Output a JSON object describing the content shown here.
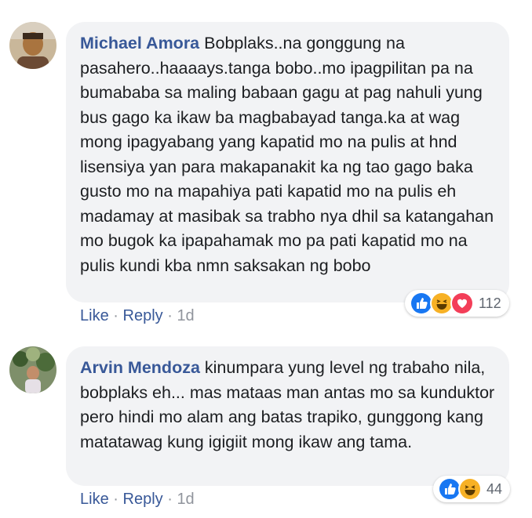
{
  "comments": [
    {
      "author": "Michael Amora",
      "text": "Bobplaks..na gonggung na pasahero..haaaays.tanga bobo..mo ipagpilitan pa na bumababa sa maling babaan gagu at pag nahuli yung bus gago ka ikaw ba magbabayad tanga.ka at wag mong ipagyabang yang kapatid mo na pulis at hnd lisensiya yan para makapanakit ka ng tao gago baka gusto mo na mapahiya pati kapatid mo na pulis eh madamay at masibak sa trabho nya dhil sa katangahan mo bugok ka ipapahamak mo pa pati kapatid mo na pulis kundi kba nmn saksakan ng bobo",
      "reactions": [
        "like-icon",
        "haha-icon",
        "love-icon"
      ],
      "reaction_count": "112",
      "like_label": "Like",
      "reply_label": "Reply",
      "separator": "·",
      "time": "1d"
    },
    {
      "author": "Arvin Mendoza",
      "text": "kinumpara yung level ng trabaho nila, bobplaks eh... mas mataas man antas mo sa kunduktor pero hindi mo alam ang batas trapiko, gunggong kang matatawag kung igigiit mong ikaw ang tama.",
      "reactions": [
        "like-icon",
        "haha-icon"
      ],
      "reaction_count": "44",
      "like_label": "Like",
      "reply_label": "Reply",
      "separator": "·",
      "time": "1d"
    }
  ],
  "colors": {
    "author": "#385898",
    "bubble": "#f2f3f5",
    "meta": "#90949c",
    "like": "#1877f2",
    "haha": "#f7b125",
    "love": "#f33e58"
  }
}
